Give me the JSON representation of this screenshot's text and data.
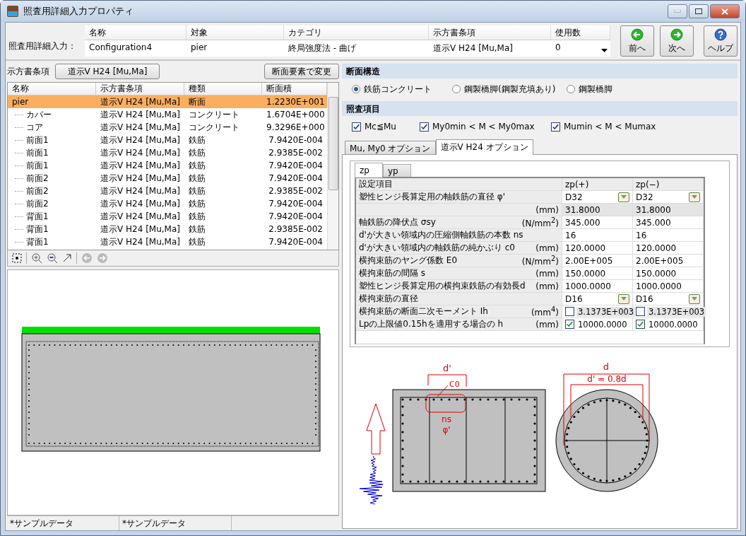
{
  "window": {
    "title": "照査用詳細入力プロパティ"
  },
  "header": {
    "label": "照査用詳細入力：",
    "columns": [
      "名称",
      "対象",
      "カテゴリ",
      "示方書条項",
      "使用数"
    ],
    "values": [
      "Configuration4",
      "pier",
      "終局強度法 - 曲げ",
      "道示V H24 [Mu,Ma]",
      "0"
    ],
    "buttons": [
      {
        "kind": "prev",
        "label": "前へ"
      },
      {
        "kind": "next",
        "label": "次へ"
      },
      {
        "kind": "help",
        "label": "ヘルプ"
      }
    ]
  },
  "left": {
    "spec_label": "示方書条項",
    "spec_button": "道示V H24 [Mu,Ma]",
    "change_button": "断面要素で変更",
    "tree": {
      "columns": [
        "名称",
        "示方書条項",
        "種類",
        "断面積"
      ],
      "rows": [
        {
          "name": "pier",
          "clause": "道示V H24 [Mu,Ma]",
          "type": "断面",
          "area": "1.2230E+001",
          "selected": true,
          "children": [
            {
              "name": "カバー",
              "clause": "道示V H24 [Mu,Ma]",
              "type": "コンクリート",
              "area": "1.6704E+000",
              "selected": false
            },
            {
              "name": "コア",
              "clause": "道示V H24 [Mu,Ma]",
              "type": "コンクリート",
              "area": "9.3296E+000",
              "selected": false
            },
            {
              "name": "前面1",
              "clause": "道示V H24 [Mu,Ma]",
              "type": "鉄筋",
              "area": "7.9420E-004",
              "selected": false
            },
            {
              "name": "前面1",
              "clause": "道示V H24 [Mu,Ma]",
              "type": "鉄筋",
              "area": "2.9385E-002",
              "selected": false
            },
            {
              "name": "前面1",
              "clause": "道示V H24 [Mu,Ma]",
              "type": "鉄筋",
              "area": "7.9420E-004",
              "selected": false
            },
            {
              "name": "前面2",
              "clause": "道示V H24 [Mu,Ma]",
              "type": "鉄筋",
              "area": "7.9420E-004",
              "selected": false
            },
            {
              "name": "前面2",
              "clause": "道示V H24 [Mu,Ma]",
              "type": "鉄筋",
              "area": "2.9385E-002",
              "selected": false
            },
            {
              "name": "前面2",
              "clause": "道示V H24 [Mu,Ma]",
              "type": "鉄筋",
              "area": "7.9420E-004",
              "selected": false
            },
            {
              "name": "背面1",
              "clause": "道示V H24 [Mu,Ma]",
              "type": "鉄筋",
              "area": "7.9420E-004",
              "selected": false
            },
            {
              "name": "背面1",
              "clause": "道示V H24 [Mu,Ma]",
              "type": "鉄筋",
              "area": "2.9385E-002",
              "selected": false
            },
            {
              "name": "背面1",
              "clause": "道示V H24 [Mu,Ma]",
              "type": "鉄筋",
              "area": "7.9420E-004",
              "selected": false
            }
          ]
        }
      ]
    }
  },
  "status_bar": [
    "*サンプルデータ",
    "*サンプルデータ"
  ],
  "section_structure": {
    "title": "断面構造",
    "options": [
      {
        "label": "鉄筋コンクリート",
        "selected": true
      },
      {
        "label": "鋼製橋脚(鋼製充填あり)",
        "selected": false
      },
      {
        "label": "鋼製橋脚",
        "selected": false
      }
    ]
  },
  "check_items": {
    "title": "照査項目",
    "options": [
      {
        "label": "Mc≦Mu",
        "checked": true
      },
      {
        "label": "My0min < M < My0max",
        "checked": true
      },
      {
        "label": "Mumin < M < Mumax",
        "checked": true
      }
    ]
  },
  "tabs": [
    {
      "label": "Mu, My0 オプション",
      "selected": false
    },
    {
      "label": "道示V H24 オプション",
      "selected": true
    }
  ],
  "subtabs": [
    {
      "label": "zp",
      "selected": true
    },
    {
      "label": "yp",
      "selected": false
    }
  ],
  "table": {
    "columns": [
      "設定項目",
      "zp(+)",
      "zp(−)"
    ],
    "rows": [
      {
        "label": "塑性ヒンジ長算定用の軸鉄筋の直径 φ'",
        "values": [
          {
            "kind": "dropdown",
            "text": "D32"
          },
          {
            "kind": "dropdown",
            "text": "D32"
          }
        ]
      },
      {
        "unit": "(mm)",
        "values": [
          {
            "kind": "readonly",
            "text": "31.8000"
          },
          {
            "kind": "readonly",
            "text": "31.8000"
          }
        ]
      },
      {
        "label": "軸鉄筋の降伏点 σsy",
        "unit": "(N/mm$^{2}$)",
        "values": [
          {
            "kind": "text",
            "text": "345.000"
          },
          {
            "kind": "text",
            "text": "345.000"
          }
        ]
      },
      {
        "label": "d'が大きい領域内の圧縮側軸鉄筋の本数 ns",
        "values": [
          {
            "kind": "text",
            "text": "16"
          },
          {
            "kind": "text",
            "text": "16"
          }
        ]
      },
      {
        "label": "d'が大きい領域内の軸鉄筋の純かぶり c0",
        "unit": "(mm)",
        "values": [
          {
            "kind": "text",
            "text": "120.0000"
          },
          {
            "kind": "text",
            "text": "120.0000"
          }
        ]
      },
      {
        "label": "横拘束筋のヤング係数 E0",
        "unit": "(N/mm$^{2}$)",
        "values": [
          {
            "kind": "text",
            "text": "2.00E+005"
          },
          {
            "kind": "text",
            "text": "2.00E+005"
          }
        ]
      },
      {
        "label": "横拘束筋の間隔 s",
        "unit": "(mm)",
        "values": [
          {
            "kind": "text",
            "text": "150.0000"
          },
          {
            "kind": "text",
            "text": "150.0000"
          }
        ]
      },
      {
        "label": "塑性ヒンジ長算定用の横拘束鉄筋の有効長d",
        "unit": "(mm)",
        "values": [
          {
            "kind": "text",
            "text": "1000.0000"
          },
          {
            "kind": "text",
            "text": "1000.0000"
          }
        ]
      },
      {
        "label": "横拘束筋の直径",
        "values": [
          {
            "kind": "dropdown",
            "text": "D16"
          },
          {
            "kind": "dropdown",
            "text": "D16"
          }
        ]
      },
      {
        "label": "横拘束筋の断面二次モーメント Ih",
        "unit": "(mm$^{4}$)",
        "values": [
          {
            "kind": "checkbox",
            "checked": false,
            "text": "3.1373E+003"
          },
          {
            "kind": "checkbox",
            "checked": false,
            "text": "3.1373E+003"
          }
        ]
      },
      {
        "label": "Lpの上限値0.15hを適用する場合の h",
        "unit": "(mm)",
        "values": [
          {
            "kind": "checkbox",
            "checked": true,
            "text": "10000.0000"
          },
          {
            "kind": "checkbox",
            "checked": true,
            "text": "10000.0000"
          }
        ]
      }
    ]
  },
  "diagram": {
    "d_prime": "d'",
    "c0": "C0",
    "ns": "ns",
    "phi": "φ'",
    "d": "d",
    "d_ratio": "d' = 0.8d"
  }
}
